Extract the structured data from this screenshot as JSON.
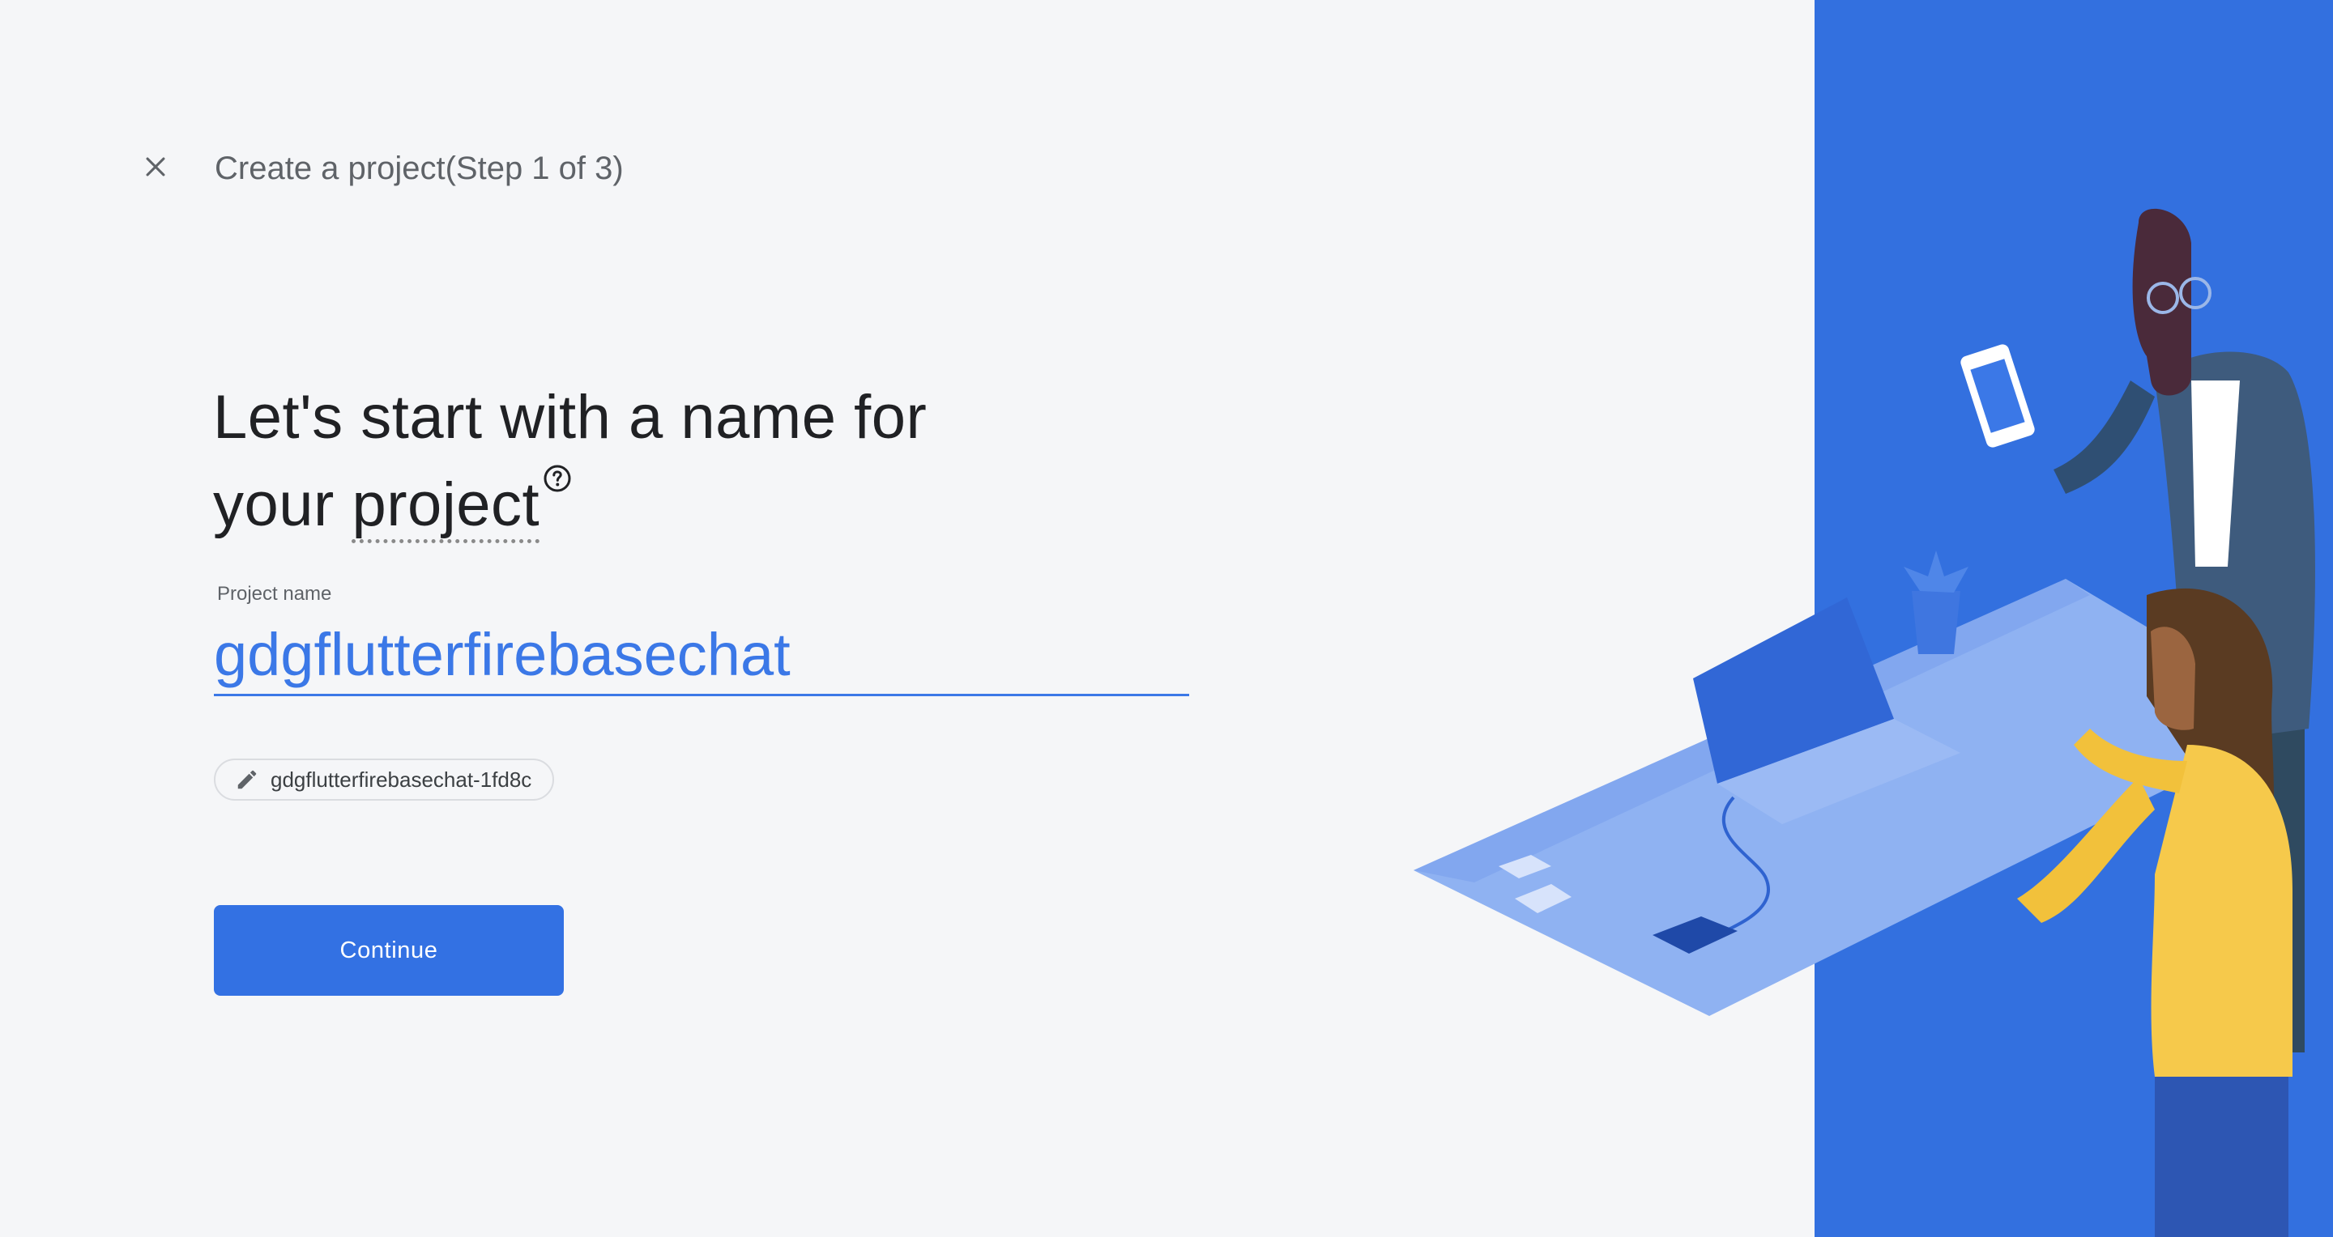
{
  "header": {
    "close_icon": "close-icon",
    "step_title": "Create a project(Step 1 of 3)"
  },
  "headline": {
    "line1": "Let's start with a name for",
    "line2_prefix": "your ",
    "line2_term": "project",
    "help_icon": "help-circle-icon"
  },
  "project_name": {
    "label": "Project name",
    "value": "gdgflutterfirebasechat"
  },
  "project_id": {
    "edit_icon": "pencil-icon",
    "value": "gdgflutterfirebasechat-1fd8c"
  },
  "actions": {
    "continue_label": "Continue"
  },
  "colors": {
    "accent": "#3b78e7",
    "button": "#3371e3",
    "background": "#f5f6f8",
    "illustration_panel": "#3370df"
  }
}
